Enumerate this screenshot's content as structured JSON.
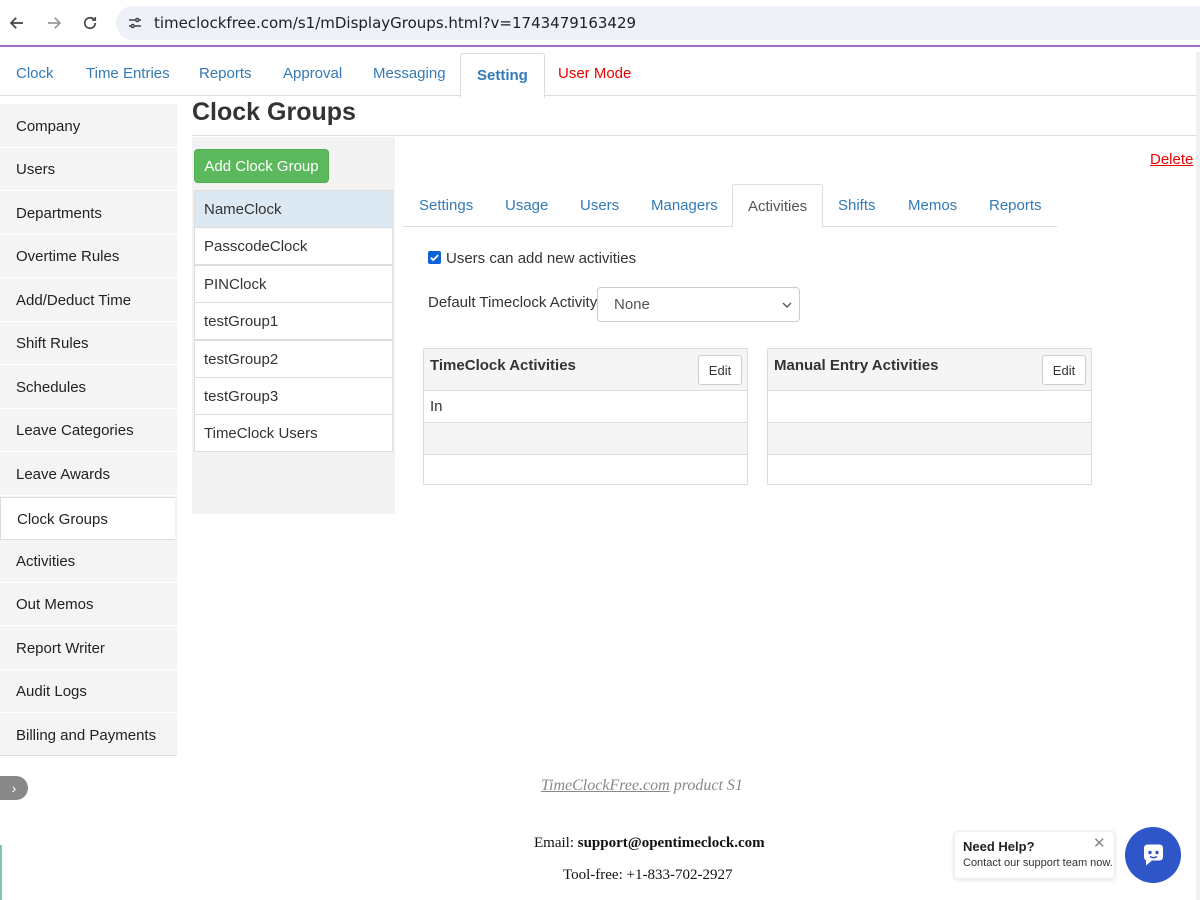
{
  "browser": {
    "url": "timeclockfree.com/s1/mDisplayGroups.html?v=1743479163429"
  },
  "top_nav": {
    "tabs": [
      {
        "label": "Clock"
      },
      {
        "label": "Time Entries"
      },
      {
        "label": "Reports"
      },
      {
        "label": "Approval"
      },
      {
        "label": "Messaging"
      },
      {
        "label": "Setting"
      },
      {
        "label": "User Mode"
      }
    ],
    "active_tab": "Setting",
    "user_mode_color": "#ee0000"
  },
  "sidebar": {
    "items": [
      {
        "label": "Company"
      },
      {
        "label": "Users"
      },
      {
        "label": "Departments"
      },
      {
        "label": "Overtime Rules"
      },
      {
        "label": "Add/Deduct Time"
      },
      {
        "label": "Shift Rules"
      },
      {
        "label": "Schedules"
      },
      {
        "label": "Leave Categories"
      },
      {
        "label": "Leave Awards"
      },
      {
        "label": "Clock Groups"
      },
      {
        "label": "Activities"
      },
      {
        "label": "Out Memos"
      },
      {
        "label": "Report Writer"
      },
      {
        "label": "Audit Logs"
      },
      {
        "label": "Billing and Payments"
      }
    ],
    "active_item": "Clock Groups",
    "collapse_label": "›"
  },
  "page": {
    "title": "Clock Groups",
    "add_button": "Add Clock Group",
    "delete_link": "Delete",
    "groups": [
      {
        "label": "NameClock"
      },
      {
        "label": "PasscodeClock"
      },
      {
        "label": "PINClock"
      },
      {
        "label": "testGroup1"
      },
      {
        "label": "testGroup2"
      },
      {
        "label": "testGroup3"
      },
      {
        "label": "TimeClock Users"
      }
    ],
    "selected_group": "NameClock"
  },
  "sub_tabs": {
    "tabs": [
      {
        "label": "Settings"
      },
      {
        "label": "Usage"
      },
      {
        "label": "Users"
      },
      {
        "label": "Managers"
      },
      {
        "label": "Activities"
      },
      {
        "label": "Shifts"
      },
      {
        "label": "Memos"
      },
      {
        "label": "Reports"
      }
    ],
    "active_tab": "Activities"
  },
  "activities": {
    "allow_new_label": "Users can add new activities",
    "allow_new_checked": true,
    "default_label": "Default Timeclock Activity:",
    "default_value": "None",
    "timeclock_table": {
      "title": "TimeClock Activities",
      "edit_label": "Edit",
      "rows": [
        "In",
        "",
        ""
      ]
    },
    "manual_table": {
      "title": "Manual Entry Activities",
      "edit_label": "Edit",
      "rows": [
        "",
        "",
        ""
      ]
    }
  },
  "footer": {
    "product_link": "TimeClockFree.com",
    "product_suffix": " product S1",
    "email_label": "Email: ",
    "email": "support@opentimeclock.com",
    "phone": "Tool-free: +1-833-702-2927"
  },
  "help": {
    "title": "Need Help?",
    "subtitle": "Contact our support team now.",
    "close": "✕"
  },
  "colors": {
    "link": "#337ab7",
    "accent_green": "#5cb85c",
    "help_blue": "#2f56c9",
    "delete_red": "#ee0000"
  }
}
